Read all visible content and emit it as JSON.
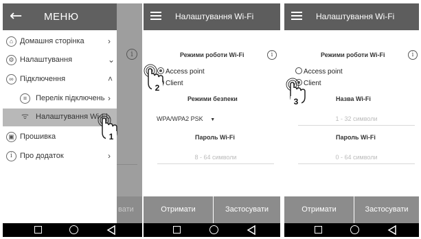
{
  "panel1": {
    "menu_title": "МЕНЮ",
    "items": [
      {
        "label": "Домашня сторінка",
        "arrow": "›"
      },
      {
        "label": "Налаштування",
        "arrow": "⌄"
      },
      {
        "label": "Підключення",
        "arrow": "˄"
      },
      {
        "label": "Перелік підключень",
        "arrow": "›"
      },
      {
        "label": "Налаштування Wi-Fi",
        "arrow": "›"
      },
      {
        "label": "Прошивка",
        "arrow": "›"
      },
      {
        "label": "Про додаток",
        "arrow": "›"
      }
    ],
    "bg_footer_partial": "вати",
    "step": "1"
  },
  "panel2": {
    "header_title": "Налаштування Wi-Fi",
    "modes_title": "Режими роботи Wi-Fi",
    "mode_options": [
      "Access point",
      "Client"
    ],
    "security_title": "Режими безпеки",
    "security_value": "WPA/WPA2 PSK",
    "password_title": "Пароль Wi-Fi",
    "password_placeholder": "8 - 64 символи",
    "btn_receive": "Отримати",
    "btn_apply": "Застосувати",
    "step": "2"
  },
  "panel3": {
    "header_title": "Налаштування Wi-Fi",
    "modes_title": "Режими роботи Wi-Fi",
    "mode_options": [
      "Access point",
      "Client"
    ],
    "name_title": "Назва Wi-Fi",
    "name_placeholder": "1 - 32 символи",
    "password_title": "Пароль Wi-Fi",
    "password_placeholder": "0 - 64 символи",
    "btn_receive": "Отримати",
    "btn_apply": "Застосувати",
    "step": "3"
  },
  "icons": {
    "info": "i",
    "back": "←"
  },
  "colors": {
    "header": "#5d5d5d",
    "footer_button": "#8c8c8c",
    "selected_item": "#b8b8b8",
    "navbar": "#000000"
  }
}
